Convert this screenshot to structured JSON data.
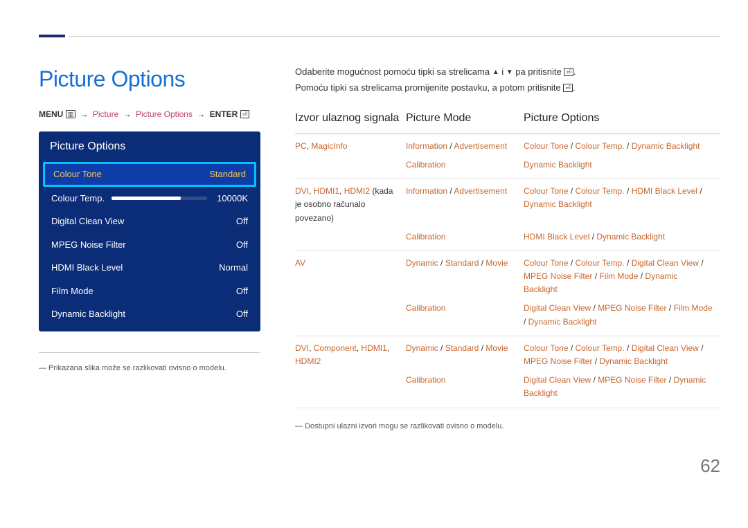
{
  "page_number": "62",
  "heading": "Picture Options",
  "breadcrumb": {
    "menu": "MENU",
    "menu_icon": "▥",
    "path1": "Picture",
    "path2": "Picture Options",
    "enter": "ENTER",
    "enter_icon": "⏎"
  },
  "intro_line1_a": "Odaberite mogućnost pomoću tipki sa strelicama ",
  "intro_line1_b": " i ",
  "intro_line1_c": " pa pritisnite ",
  "intro_line1_d": ".",
  "intro_line2_a": "Pomoću tipki sa strelicama promijenite postavku, a potom pritisnite ",
  "intro_line2_b": ".",
  "osd": {
    "title": "Picture Options",
    "items": [
      {
        "label": "Colour Tone",
        "value": "Standard",
        "selected": true
      },
      {
        "label": "Colour Temp.",
        "value": "10000K",
        "slider": true
      },
      {
        "label": "Digital Clean View",
        "value": "Off"
      },
      {
        "label": "MPEG Noise Filter",
        "value": "Off"
      },
      {
        "label": "HDMI Black Level",
        "value": "Normal"
      },
      {
        "label": "Film Mode",
        "value": "Off"
      },
      {
        "label": "Dynamic Backlight",
        "value": "Off"
      }
    ]
  },
  "note_left": "Prikazana slika može se razlikovati ovisno o modelu.",
  "table_headers": {
    "source": "Izvor ulaznog signala",
    "mode": "Picture Mode",
    "options": "Picture Options"
  },
  "rows": [
    {
      "source_parts": [
        {
          "t": "PC",
          "o": true
        },
        {
          "t": ", ",
          "o": false
        },
        {
          "t": "MagicInfo",
          "o": true
        }
      ],
      "mode_parts": [
        {
          "t": "Information",
          "o": true
        },
        {
          "t": " / ",
          "o": false
        },
        {
          "t": "Advertisement",
          "o": true
        }
      ],
      "opt_parts": [
        {
          "t": "Colour Tone",
          "o": true
        },
        {
          "t": " / ",
          "o": false
        },
        {
          "t": "Colour Temp.",
          "o": true
        },
        {
          "t": " / ",
          "o": false
        },
        {
          "t": "Dynamic Backlight",
          "o": true
        }
      ]
    },
    {
      "source_parts": [],
      "mode_parts": [
        {
          "t": "Calibration",
          "o": true
        }
      ],
      "opt_parts": [
        {
          "t": "Dynamic Backlight",
          "o": true
        }
      ]
    },
    {
      "source_parts": [
        {
          "t": "DVI",
          "o": true
        },
        {
          "t": ", ",
          "o": false
        },
        {
          "t": "HDMI1",
          "o": true
        },
        {
          "t": ", ",
          "o": false
        },
        {
          "t": "HDMI2",
          "o": true
        },
        {
          "t": " (kada je osobno računalo povezano)",
          "o": false
        }
      ],
      "mode_parts": [
        {
          "t": "Information",
          "o": true
        },
        {
          "t": " / ",
          "o": false
        },
        {
          "t": "Advertisement",
          "o": true
        }
      ],
      "opt_parts": [
        {
          "t": "Colour Tone",
          "o": true
        },
        {
          "t": " / ",
          "o": false
        },
        {
          "t": "Colour Temp.",
          "o": true
        },
        {
          "t": " / ",
          "o": false
        },
        {
          "t": "HDMI Black Level",
          "o": true
        },
        {
          "t": " / ",
          "o": false
        },
        {
          "t": "Dynamic Backlight",
          "o": true
        }
      ]
    },
    {
      "source_parts": [],
      "mode_parts": [
        {
          "t": "Calibration",
          "o": true
        }
      ],
      "opt_parts": [
        {
          "t": "HDMI Black Level",
          "o": true
        },
        {
          "t": " / ",
          "o": false
        },
        {
          "t": "Dynamic Backlight",
          "o": true
        }
      ]
    },
    {
      "source_parts": [
        {
          "t": "AV",
          "o": true
        }
      ],
      "mode_parts": [
        {
          "t": "Dynamic",
          "o": true
        },
        {
          "t": " / ",
          "o": false
        },
        {
          "t": "Standard",
          "o": true
        },
        {
          "t": " / ",
          "o": false
        },
        {
          "t": "Movie",
          "o": true
        }
      ],
      "opt_parts": [
        {
          "t": "Colour Tone",
          "o": true
        },
        {
          "t": " / ",
          "o": false
        },
        {
          "t": "Colour Temp.",
          "o": true
        },
        {
          "t": " / ",
          "o": false
        },
        {
          "t": "Digital Clean View",
          "o": true
        },
        {
          "t": " / ",
          "o": false
        },
        {
          "t": "MPEG Noise Filter",
          "o": true
        },
        {
          "t": " / ",
          "o": false
        },
        {
          "t": "Film Mode",
          "o": true
        },
        {
          "t": " / ",
          "o": false
        },
        {
          "t": "Dynamic Backlight",
          "o": true
        }
      ]
    },
    {
      "source_parts": [],
      "mode_parts": [
        {
          "t": "Calibration",
          "o": true
        }
      ],
      "opt_parts": [
        {
          "t": "Digital Clean View",
          "o": true
        },
        {
          "t": " / ",
          "o": false
        },
        {
          "t": "MPEG Noise Filter",
          "o": true
        },
        {
          "t": " / ",
          "o": false
        },
        {
          "t": "Film Mode",
          "o": true
        },
        {
          "t": " / ",
          "o": false
        },
        {
          "t": "Dynamic Backlight",
          "o": true
        }
      ]
    },
    {
      "source_parts": [
        {
          "t": "DVI",
          "o": true
        },
        {
          "t": ", ",
          "o": false
        },
        {
          "t": "Component",
          "o": true
        },
        {
          "t": ", ",
          "o": false
        },
        {
          "t": "HDMI1",
          "o": true
        },
        {
          "t": ", ",
          "o": false
        },
        {
          "t": "HDMI2",
          "o": true
        }
      ],
      "mode_parts": [
        {
          "t": "Dynamic",
          "o": true
        },
        {
          "t": " / ",
          "o": false
        },
        {
          "t": "Standard",
          "o": true
        },
        {
          "t": " / ",
          "o": false
        },
        {
          "t": "Movie",
          "o": true
        }
      ],
      "opt_parts": [
        {
          "t": "Colour Tone",
          "o": true
        },
        {
          "t": " / ",
          "o": false
        },
        {
          "t": "Colour Temp.",
          "o": true
        },
        {
          "t": " / ",
          "o": false
        },
        {
          "t": "Digital Clean View",
          "o": true
        },
        {
          "t": " / ",
          "o": false
        },
        {
          "t": "MPEG Noise Filter",
          "o": true
        },
        {
          "t": " / ",
          "o": false
        },
        {
          "t": "Dynamic Backlight",
          "o": true
        }
      ]
    },
    {
      "source_parts": [],
      "mode_parts": [
        {
          "t": "Calibration",
          "o": true
        }
      ],
      "opt_parts": [
        {
          "t": "Digital Clean View",
          "o": true
        },
        {
          "t": " / ",
          "o": false
        },
        {
          "t": "MPEG Noise Filter",
          "o": true
        },
        {
          "t": " / ",
          "o": false
        },
        {
          "t": "Dynamic Backlight",
          "o": true
        }
      ]
    }
  ],
  "footnote_right": "Dostupni ulazni izvori mogu se razlikovati ovisno o modelu."
}
